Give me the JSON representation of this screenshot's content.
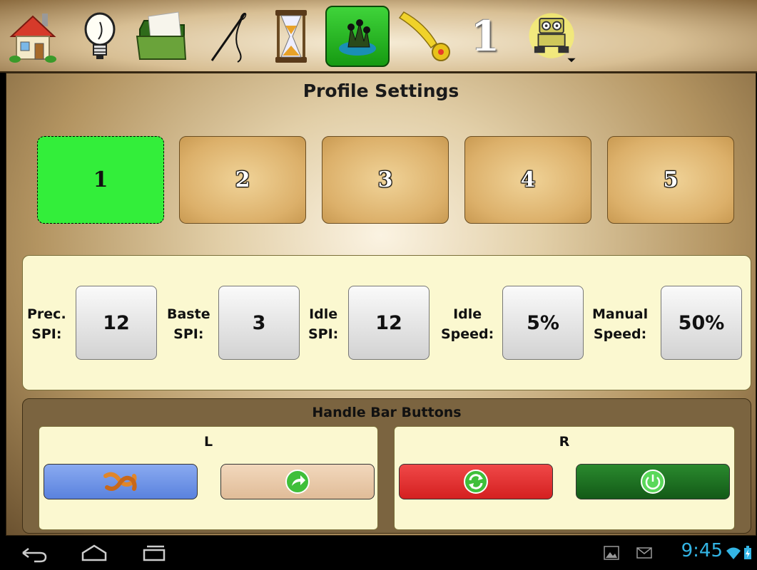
{
  "toolbar": {
    "items": [
      {
        "icon": "home-icon"
      },
      {
        "icon": "lightbulb-icon"
      },
      {
        "icon": "folder-icon"
      },
      {
        "icon": "needle-thread-icon"
      },
      {
        "icon": "hourglass-icon"
      },
      {
        "icon": "profile-settings-icon",
        "active": true
      },
      {
        "icon": "tape-measure-icon"
      },
      {
        "icon": "number-one-icon",
        "label": "1"
      },
      {
        "icon": "robot-icon"
      }
    ]
  },
  "page": {
    "title": "Profile Settings"
  },
  "profiles": {
    "labels": [
      "1",
      "2",
      "3",
      "4",
      "5"
    ],
    "selected": "1"
  },
  "settings": {
    "prec_spi": {
      "label_line1": "Prec.",
      "label_line2": "SPI:",
      "value": "12"
    },
    "baste_spi": {
      "label_line1": "Baste",
      "label_line2": "SPI:",
      "value": "3"
    },
    "idle_spi": {
      "label_line1": "Idle",
      "label_line2": "SPI:",
      "value": "12"
    },
    "idle_speed": {
      "label_line1": "Idle",
      "label_line2": "Speed:",
      "value": "5%"
    },
    "manual_speed": {
      "label_line1": "Manual",
      "label_line2": "Speed:",
      "value": "50%"
    }
  },
  "handle_bar": {
    "title": "Handle Bar Buttons",
    "left": {
      "label": "L",
      "buttons": [
        {
          "icon": "knot-icon",
          "color": "#6f93e3"
        },
        {
          "icon": "forward-arrow-icon",
          "color": "#e9c9a8"
        }
      ]
    },
    "right": {
      "label": "R",
      "buttons": [
        {
          "icon": "refresh-icon",
          "color": "#e32a2a"
        },
        {
          "icon": "power-icon",
          "color": "#1e6f22"
        }
      ]
    }
  },
  "status_bar": {
    "time": "9:45"
  },
  "colors": {
    "active_green": "#33ee3a",
    "accent_blue": "#33b5e5"
  }
}
